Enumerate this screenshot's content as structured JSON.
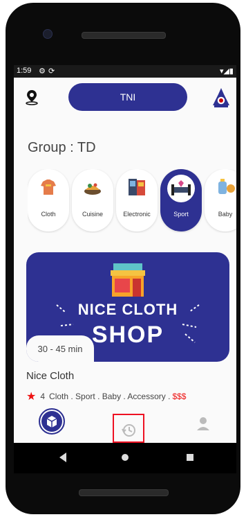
{
  "status_bar": {
    "time": "1:59"
  },
  "header": {
    "title": "TNI"
  },
  "group": {
    "label": "Group : TD"
  },
  "categories": [
    {
      "label": "Cloth"
    },
    {
      "label": "Cuisine"
    },
    {
      "label": "Electronic"
    },
    {
      "label": "Sport"
    },
    {
      "label": "Baby"
    }
  ],
  "banner": {
    "title": "NICE CLOTH",
    "subtitle": "SHOP",
    "delivery_time": "30 - 45 min"
  },
  "shop": {
    "name": "Nice Cloth",
    "rating": "4",
    "tags": "Cloth . Sport . Baby . Accessory .",
    "price": "$$$"
  },
  "colors": {
    "primary": "#2e3192",
    "accent_red": "#e11111"
  },
  "icons": {
    "location": "location-pin-icon",
    "logo": "tni-logo-icon",
    "home": "home-box-icon",
    "history": "history-clock-icon",
    "profile": "user-icon"
  }
}
